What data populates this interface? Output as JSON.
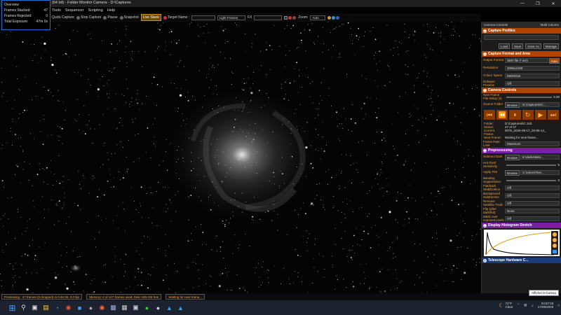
{
  "window": {
    "title": "(64 bit) - Folder Monitor Camera - D:\\Captures"
  },
  "menu": [
    "Tools",
    "Sequencer",
    "Scripting",
    "Help"
  ],
  "toolbar": {
    "quick_capture": "Quick Capture",
    "stop_capture": "Stop Capture",
    "pause": "Pause",
    "snapshot": "Snapshot",
    "live_stack": "Live Stack",
    "target_name": "Target Name",
    "light_frames": "Light Frames",
    "fx": "FX",
    "zoom_label": "Zoom:",
    "zoom_value": "Auto"
  },
  "overview": {
    "title": "Overview",
    "frames_stacked_label": "Frames Stacked:",
    "frames_stacked": "47",
    "frames_rejected_label": "Frames Rejected:",
    "frames_rejected": "0",
    "total_exposure_label": "Total Exposure:",
    "total_exposure": "47m 0s"
  },
  "panel": {
    "header": "Camera Controls",
    "header_right": "Multi Column",
    "capture_profiles": "Capture Profiles",
    "load": "Load",
    "save": "Save",
    "save_as": "Save As",
    "manage": "Manage",
    "capture_format": "Capture Format and Area",
    "output_format_label": "Output Format",
    "output_format": "SER file (*.ser)",
    "output_auto": "Auto",
    "resolution_label": "Resolution",
    "resolution": "3096x2180",
    "colour_space_label": "Colour Space",
    "colour_space": "MONO16",
    "debayer_label": "Debayer Preview",
    "debayer": "Off",
    "camera_controls": "Camera Controls",
    "new_frame_label": "New Frame File Delay (s)",
    "new_frame_value": "5.00",
    "source_folder_label": "Source Folder",
    "browse": "Browse",
    "source_folder": "D:\\Captures\\IC...",
    "folder_label": "Folder:",
    "folder": "D:\\Captures\\IC 342",
    "status_label": "Status:",
    "status": "47 of 47",
    "current_frame_label": "Current Frame:",
    "current_frame": "0076_2026-09-17_03-55-14_",
    "next_frame_label": "Next Frame:",
    "next_frame": "Waiting for next frame...",
    "frame_rate_label": "Frame Rate Limit",
    "frame_rate": "Maximum",
    "preprocessing": "Preprocessing",
    "subtract_dark_label": "Subtract Dark",
    "subtract_dark": "E:\\darks\\Mini...",
    "hot_pixel_label": "Hot Pixel Sensitivity",
    "hot_pixel_value": "5",
    "apply_flat_label": "Apply Flat",
    "apply_flat": "C:\\Users\\Tosi...",
    "banding_label": "Banding Suppression",
    "banding_value": "0",
    "flat_dark_label": "Flat/Dark Stabilization",
    "flat_dark": "Off",
    "bg_sub_label": "Background Subtraction",
    "bg_sub": "Off",
    "remove_sat_label": "Remove Satellite Trails",
    "remove_sat": "Off",
    "flip_label": "Flip (after dark/flat)",
    "flip": "None",
    "mask_label": "Mask over exposed pixels",
    "mask": "Off",
    "histogram": "Display Histogram Stretch",
    "telescope": "Telescope Hardware C..."
  },
  "statusbar": {
    "previewing": "Previewing : 47 frames (0 dropped) in 0:46:26, 0.0 fps",
    "memory": "Memory: 4 of 127 frames used, Disk: 825 GB free",
    "waiting": "Waiting for next frame..."
  },
  "taskbar": {
    "weather": "74°F",
    "weather_sub": "Clear",
    "time": "03:57:03",
    "date": "17/09/2026"
  },
  "tooltip": "Afficher le bureau"
}
